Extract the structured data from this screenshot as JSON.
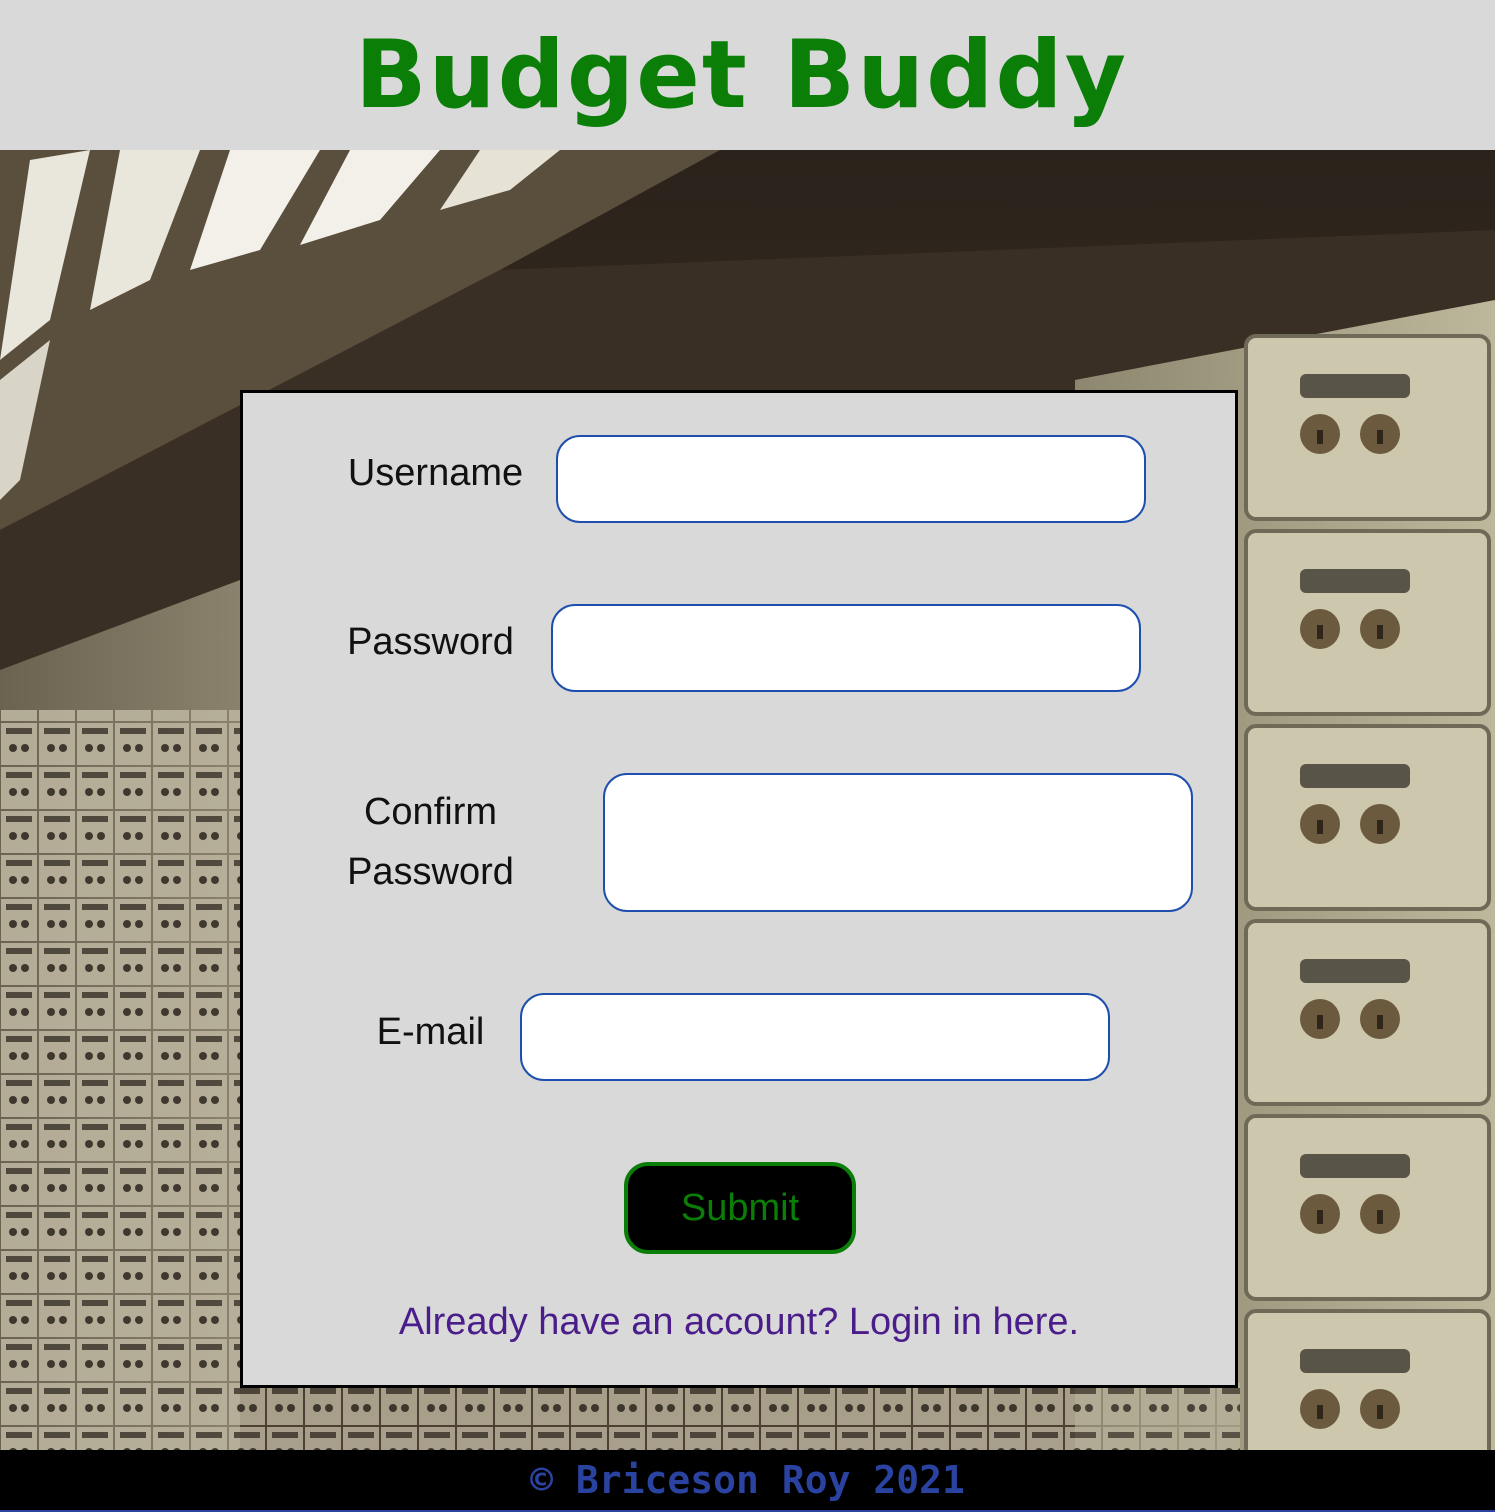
{
  "header": {
    "title": "Budget Buddy"
  },
  "colors": {
    "title_green": "#0a7e07",
    "input_border": "#1e4fae",
    "link_purple": "#4a1d8a",
    "footer_blue": "#2a43a0",
    "panel_gray": "#d9d9d9"
  },
  "form": {
    "username_label": "Username",
    "username_value": "",
    "password_label": "Password",
    "password_value": "",
    "confirm_label_line1": "Confirm",
    "confirm_label_line2": "Password",
    "confirm_value": "",
    "email_label": "E-mail",
    "email_value": "",
    "submit_label": "Submit",
    "login_link_text": "Already have an account? Login in here."
  },
  "footer": {
    "text": "© Briceson Roy 2021"
  }
}
